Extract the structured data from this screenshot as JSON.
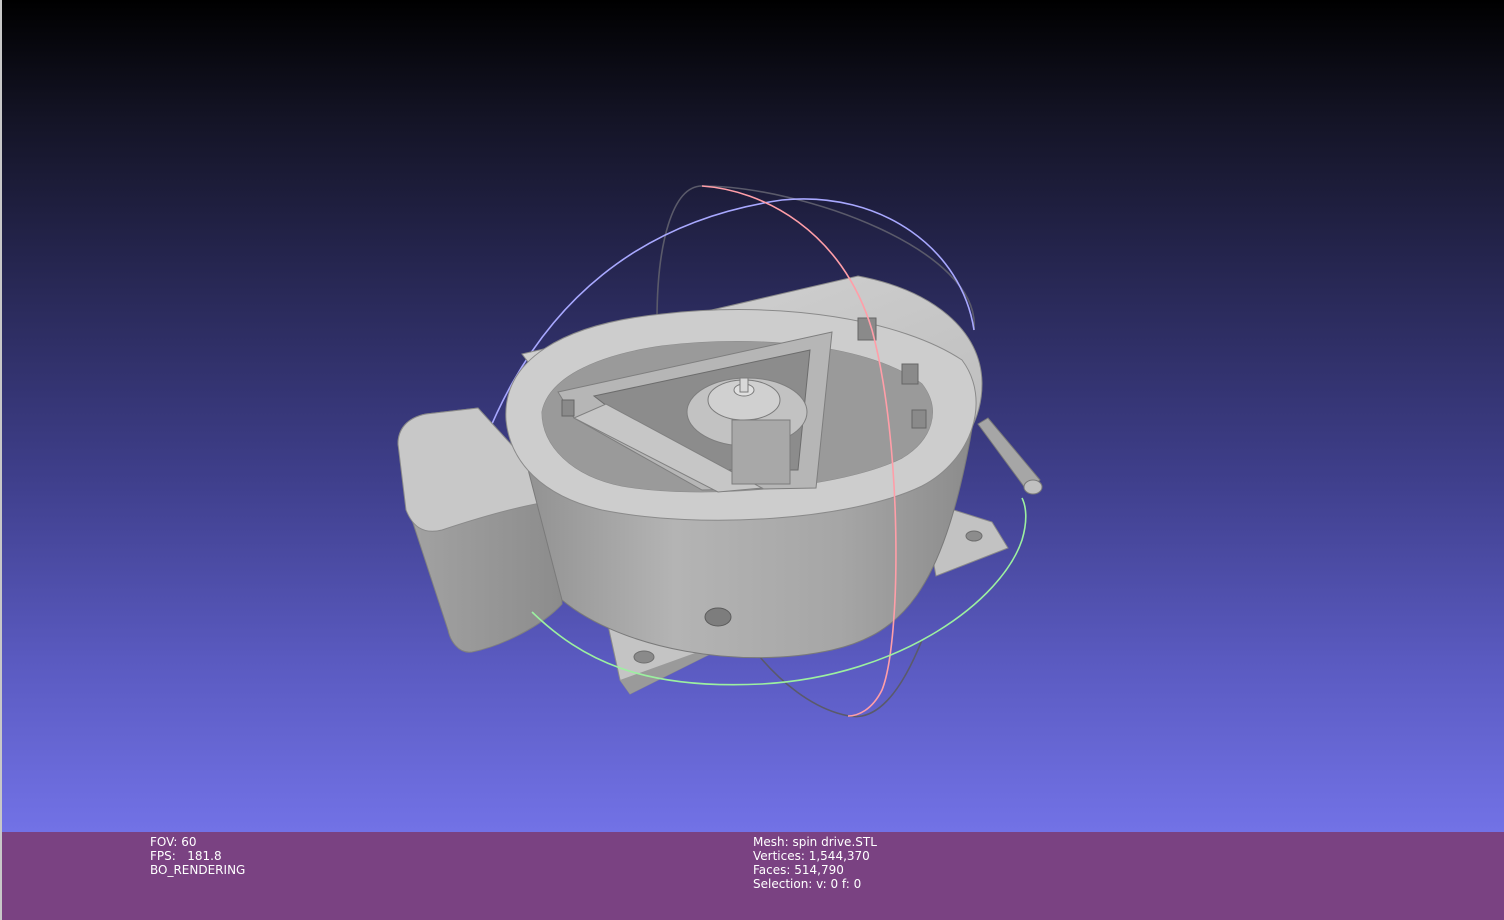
{
  "app": "MeshLab viewer",
  "viewport": {
    "background_top": "#000000",
    "background_bottom": "#7272e6",
    "trackball_colors": {
      "x_ring": "#ff9ea8",
      "y_ring": "#9cf0a0",
      "z_ring": "#a8a8ff",
      "grey_ring": "#5a5a6a"
    },
    "model_color": "#a8a8a8"
  },
  "info_bar": {
    "background": "#7a4282",
    "left": {
      "fov": "FOV: 60",
      "fps": "FPS:   181.8",
      "render_mode": "BO_RENDERING"
    },
    "right": {
      "mesh": "Mesh: spin drive.STL",
      "vertices": "Vertices: 1,544,370",
      "faces": "Faces: 514,790",
      "selection": "Selection: v: 0 f: 0"
    }
  }
}
